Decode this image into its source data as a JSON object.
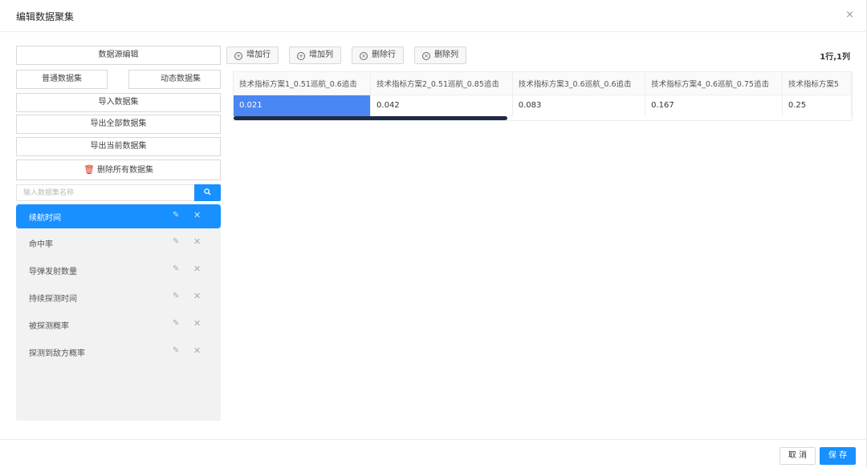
{
  "dialog": {
    "title": "编辑数据聚集",
    "close_glyph": "×"
  },
  "left_panel": {
    "source_edit": "数据源编辑",
    "normal_set": "普通数据集",
    "dynamic_set": "动态数据集",
    "import": "导入数据集",
    "export_all": "导出全部数据集",
    "export_current": "导出当前数据集",
    "delete_all": "删除所有数据集",
    "search_placeholder": "输入数据集名称",
    "items": [
      {
        "label": "续航时间",
        "active": true
      },
      {
        "label": "命中率"
      },
      {
        "label": "导弹发射数量"
      },
      {
        "label": "持续探测时间"
      },
      {
        "label": "被探测概率"
      },
      {
        "label": "探测到敌方概率"
      }
    ]
  },
  "toolbar": {
    "add_row": "增加行",
    "add_col": "增加列",
    "delete_row": "删除行",
    "delete_col": "删除列",
    "size_label": "1行,1列"
  },
  "table": {
    "headers": [
      "技术指标方案1_0.51巡航_0.6追击",
      "技术指标方案2_0.51巡航_0.85追击",
      "技术指标方案3_0.6巡航_0.6追击",
      "技术指标方案4_0.6巡航_0.75追击",
      "技术指标方案5"
    ],
    "rows": [
      [
        "0.021",
        "0.042",
        "0.083",
        "0.167",
        "0.25"
      ]
    ]
  },
  "footer": {
    "cancel": "取 消",
    "save": "保 存"
  },
  "colors": {
    "primary": "#1890ff",
    "selected_cell": "#4a87f3",
    "danger": "#e0301e"
  },
  "icons": {
    "close": "close-icon",
    "trash": "trash-icon",
    "search": "search-icon",
    "edit": "edit-icon",
    "delete": "delete-icon",
    "add": "plus-circle-icon",
    "remove": "x-circle-icon"
  }
}
